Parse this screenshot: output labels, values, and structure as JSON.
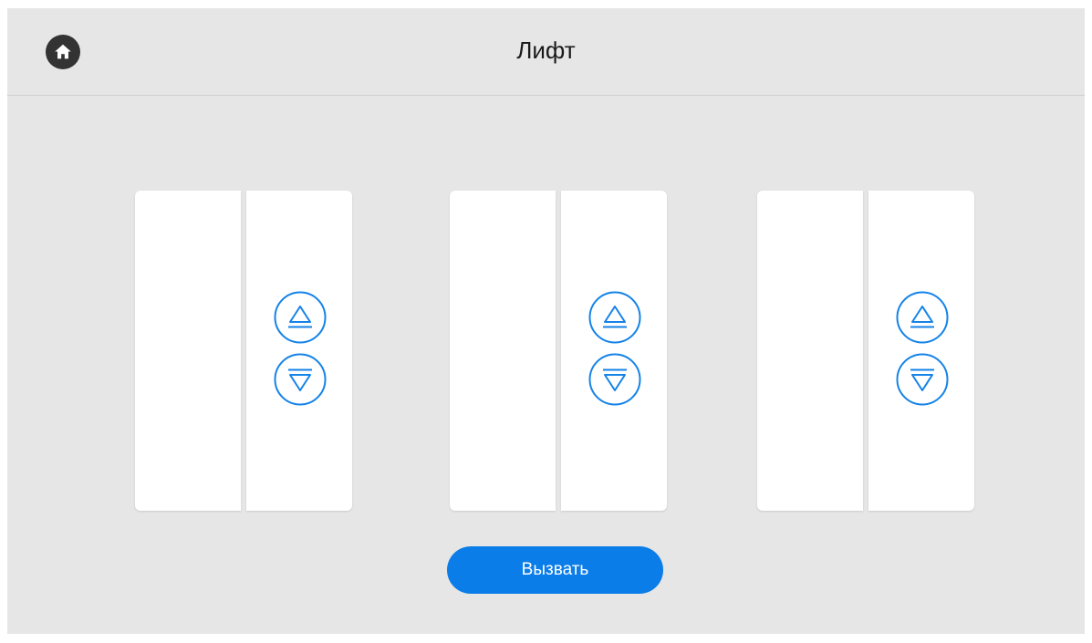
{
  "header": {
    "home_icon": "home-icon",
    "title": "Лифт"
  },
  "elevators": [
    {
      "up_icon": "up-arrow-icon",
      "down_icon": "down-arrow-icon"
    },
    {
      "up_icon": "up-arrow-icon",
      "down_icon": "down-arrow-icon"
    },
    {
      "up_icon": "up-arrow-icon",
      "down_icon": "down-arrow-icon"
    }
  ],
  "actions": {
    "call_label": "Вызвать"
  },
  "colors": {
    "background": "#e6e6e6",
    "accent": "#0a7de8",
    "icon_blue": "#1583e8",
    "home_button": "#333333"
  }
}
